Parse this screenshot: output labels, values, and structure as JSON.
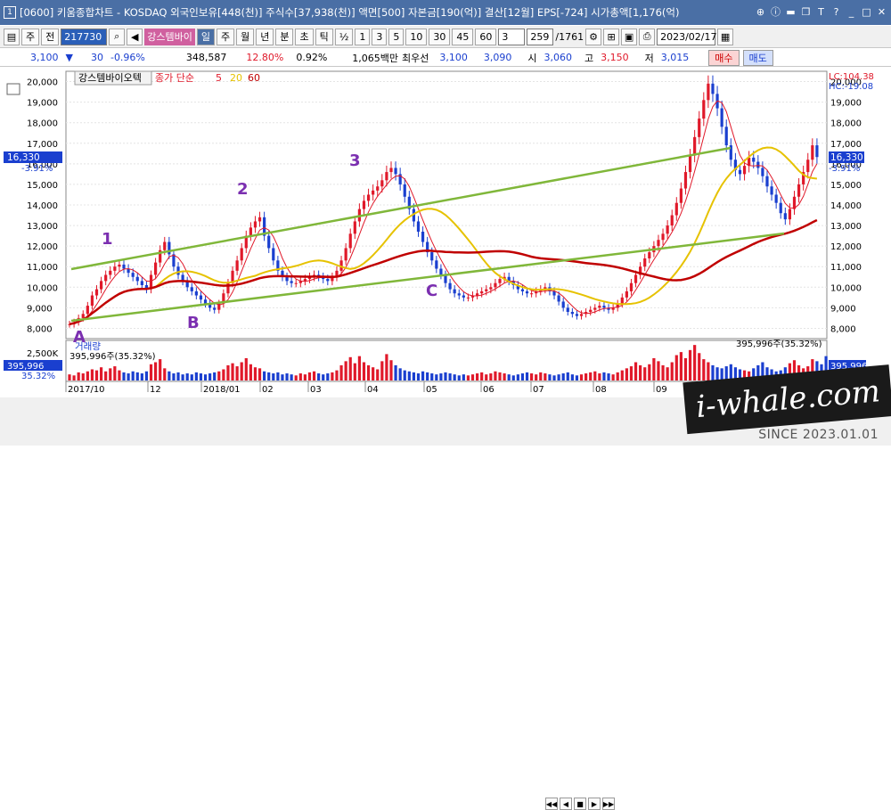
{
  "window": {
    "number": "1",
    "title": "[0600] 키움종합차트 - KOSDAQ 외국인보유[448(천)] 주식수[37,938(천)] 액면[500] 자본금[190(억)] 결산[12월] EPS[-724] 시가총액[1,176(억)"
  },
  "toolbar": {
    "period_week": "주",
    "prev": "전",
    "code": "217730",
    "stock_name": "강스템바이",
    "period_buttons": [
      "일",
      "주",
      "월",
      "년",
      "분",
      "초",
      "틱"
    ],
    "ratio": "½",
    "intervals": [
      "1",
      "3",
      "5",
      "10",
      "30",
      "45",
      "60"
    ],
    "interval_select": "3",
    "count": "259",
    "total": "/1761",
    "date": "2023/02/17"
  },
  "quote": {
    "price": "3,100",
    "change": "30",
    "change_pct": "-0.96%",
    "volume": "348,587",
    "turnover_pct": "12.80%",
    "pct2": "0.92%",
    "amount": "1,065백만",
    "best_ask_label": "최우선",
    "best_ask": "3,100",
    "best_bid": "3,090",
    "open_label": "시",
    "open": "3,060",
    "high_label": "고",
    "high": "3,150",
    "low_label": "저",
    "low": "3,015",
    "buy": "매수",
    "sell": "매도"
  },
  "chart": {
    "stock_tab": "강스템바이오텍",
    "legend_label": "종가 단순",
    "ma_periods": [
      "5",
      "20",
      "60"
    ],
    "lc": "LC:104.38",
    "hc": "HC:-19.08",
    "last_price": "16,330",
    "last_pct": "-3.91%",
    "volume_title": "거래량",
    "volume_info_left": "395,996주(35.32%)",
    "volume_info_right": "395,996주(35.32%)",
    "volume_tag": "395,996",
    "volume_pct_tag": "35.32%",
    "volume_axis_label": "2,500K",
    "x_labels": [
      "2017/10",
      "12",
      "2018/01",
      "02",
      "03",
      "04",
      "05",
      "06",
      "07",
      "08",
      "09"
    ],
    "annotations": [
      "1",
      "2",
      "3",
      "A",
      "B",
      "C"
    ]
  },
  "chart_data": {
    "type": "candlestick",
    "ylim": [
      7500,
      20500
    ],
    "y_ticks": [
      "20,000",
      "19,000",
      "18,000",
      "17,000",
      "16,000",
      "15,000",
      "14,000",
      "13,000",
      "12,000",
      "11,000",
      "10,000",
      "9,000",
      "8,000"
    ],
    "y_tick_values": [
      20000,
      19000,
      18000,
      17000,
      16000,
      15000,
      14000,
      13000,
      12000,
      11000,
      10000,
      9000,
      8000
    ],
    "closes": [
      8200,
      8300,
      8500,
      8700,
      9100,
      9600,
      9900,
      10300,
      10600,
      10800,
      11000,
      11100,
      10900,
      10700,
      10500,
      10300,
      10100,
      9900,
      10600,
      11200,
      11800,
      12200,
      11600,
      11000,
      10600,
      10300,
      10000,
      9800,
      9600,
      9400,
      9200,
      9000,
      8900,
      9200,
      9700,
      10200,
      10800,
      11300,
      11900,
      12500,
      12900,
      13200,
      13400,
      12500,
      11900,
      11300,
      10800,
      10500,
      10300,
      10200,
      10200,
      10300,
      10400,
      10500,
      10600,
      10500,
      10400,
      10300,
      10500,
      10800,
      11300,
      11900,
      12600,
      13200,
      13800,
      14200,
      14500,
      14700,
      14900,
      15200,
      15600,
      15800,
      15500,
      15000,
      14400,
      13800,
      13200,
      12700,
      12200,
      11700,
      11300,
      10900,
      10600,
      10200,
      9900,
      9700,
      9600,
      9500,
      9500,
      9600,
      9700,
      9800,
      9900,
      10000,
      10200,
      10400,
      10500,
      10300,
      10100,
      9900,
      9800,
      9700,
      9700,
      9800,
      9900,
      10000,
      9800,
      9600,
      9300,
      9000,
      8800,
      8700,
      8600,
      8700,
      8800,
      8900,
      9000,
      9100,
      9000,
      8900,
      9000,
      9200,
      9500,
      9800,
      10200,
      10600,
      11000,
      11400,
      11700,
      12000,
      12300,
      12600,
      13000,
      13500,
      14100,
      14800,
      15600,
      16400,
      17300,
      18200,
      19100,
      19900,
      19400,
      18700,
      17800,
      16900,
      16200,
      15700,
      15500,
      15900,
      16300,
      16100,
      15800,
      15400,
      14900,
      14500,
      14100,
      13600,
      13300,
      13800,
      14400,
      15000,
      15600,
      16200,
      16900,
      16330
    ],
    "volumes": [
      600,
      500,
      800,
      700,
      900,
      1100,
      1000,
      1300,
      900,
      1200,
      1400,
      1000,
      800,
      700,
      900,
      800,
      700,
      900,
      1600,
      1800,
      2100,
      1200,
      900,
      700,
      800,
      600,
      700,
      600,
      800,
      700,
      600,
      700,
      800,
      900,
      1100,
      1500,
      1700,
      1400,
      1800,
      2200,
      1600,
      1300,
      1200,
      900,
      800,
      700,
      800,
      600,
      700,
      600,
      500,
      700,
      600,
      800,
      900,
      700,
      600,
      700,
      800,
      1000,
      1500,
      1900,
      2300,
      1700,
      2400,
      1800,
      1500,
      1300,
      1100,
      1900,
      2600,
      2000,
      1500,
      1200,
      1000,
      900,
      800,
      700,
      900,
      800,
      700,
      600,
      700,
      800,
      700,
      600,
      500,
      600,
      500,
      600,
      700,
      800,
      600,
      700,
      900,
      800,
      700,
      600,
      500,
      600,
      700,
      800,
      700,
      600,
      800,
      700,
      600,
      500,
      600,
      700,
      800,
      600,
      500,
      600,
      700,
      800,
      900,
      700,
      800,
      700,
      600,
      800,
      1000,
      1200,
      1400,
      1800,
      1500,
      1300,
      1600,
      2200,
      1900,
      1500,
      1300,
      1800,
      2500,
      2800,
      2200,
      3000,
      3500,
      2700,
      2100,
      1800,
      1500,
      1300,
      1200,
      1400,
      1600,
      1300,
      1100,
      1000,
      900,
      1200,
      1500,
      1800,
      1300,
      1100,
      900,
      1000,
      1300,
      1700,
      2000,
      1500,
      1200,
      1400,
      2100,
      1900,
      1600,
      2400
    ]
  }
}
